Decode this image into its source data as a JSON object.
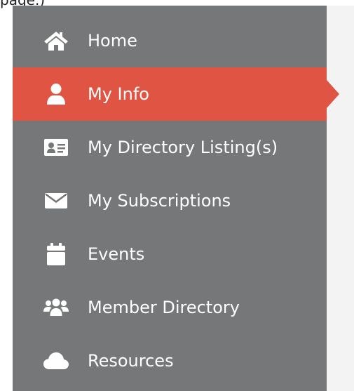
{
  "page": {
    "top_text": "page.)"
  },
  "sidebar": {
    "active_index": 1,
    "colors": {
      "background": "#757778",
      "active": "#e05443",
      "text": "#ffffff"
    },
    "items": [
      {
        "label": "Home",
        "icon": "home-icon"
      },
      {
        "label": "My Info",
        "icon": "user-icon"
      },
      {
        "label": "My Directory Listing(s)",
        "icon": "id-card-icon"
      },
      {
        "label": "My Subscriptions",
        "icon": "envelope-icon"
      },
      {
        "label": "Events",
        "icon": "calendar-icon"
      },
      {
        "label": "Member Directory",
        "icon": "users-icon"
      },
      {
        "label": "Resources",
        "icon": "cloud-icon"
      }
    ]
  }
}
